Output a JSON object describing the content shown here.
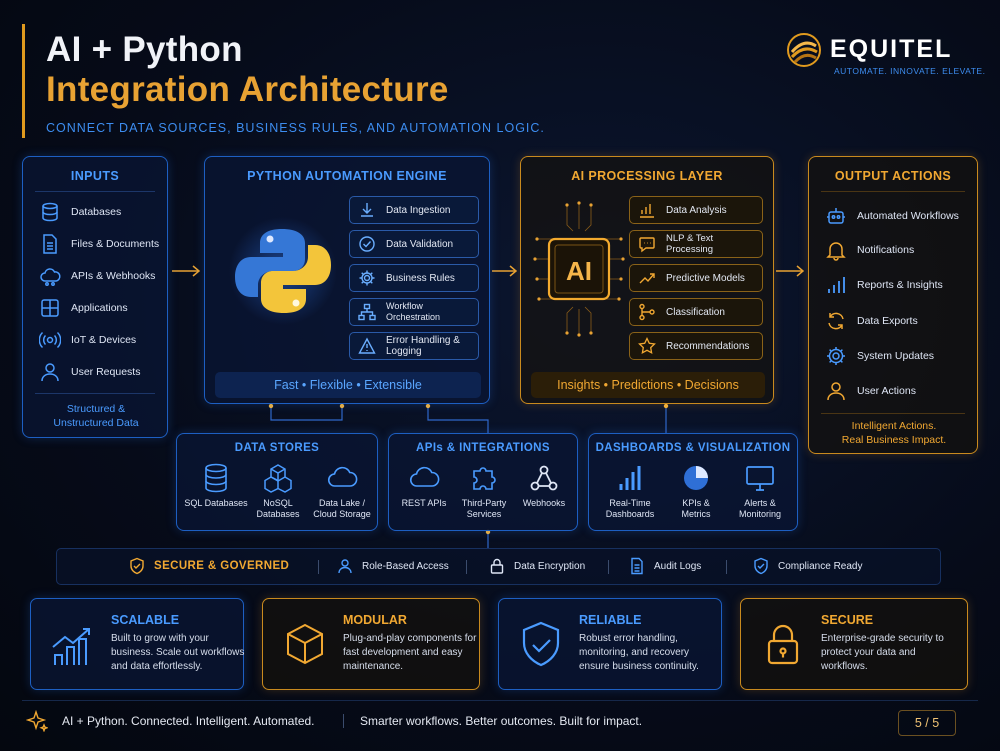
{
  "header": {
    "title_line1": "AI + Python",
    "title_line2": "Integration Architecture",
    "subtitle": "CONNECT DATA SOURCES, BUSINESS RULES, AND AUTOMATION LOGIC."
  },
  "brand": {
    "name": "EQUITEL",
    "tagline": "AUTOMATE. INNOVATE. ELEVATE."
  },
  "inputs": {
    "title": "INPUTS",
    "items": [
      "Databases",
      "Files & Documents",
      "APIs & Webhooks",
      "Applications",
      "IoT & Devices",
      "User Requests"
    ],
    "footer_line1": "Structured &",
    "footer_line2": "Unstructured Data"
  },
  "python_engine": {
    "title": "PYTHON AUTOMATION ENGINE",
    "steps": [
      "Data Ingestion",
      "Data Validation",
      "Business Rules",
      "Workflow Orchestration",
      "Error Handling &",
      "Logging"
    ],
    "footer": "Fast  •  Flexible  •  Extensible"
  },
  "ai_layer": {
    "title": "AI PROCESSING LAYER",
    "chip_label": "AI",
    "steps": [
      "Data Analysis",
      "NLP & Text Processing",
      "Predictive Models",
      "Classification",
      "Recommendations"
    ],
    "footer": "Insights  •  Predictions  •  Decisions"
  },
  "outputs": {
    "title": "OUTPUT ACTIONS",
    "items": [
      "Automated Workflows",
      "Notifications",
      "Reports & Insights",
      "Data Exports",
      "System Updates",
      "User Actions"
    ],
    "footer_line1": "Intelligent Actions.",
    "footer_line2": "Real Business Impact."
  },
  "data_stores": {
    "title": "DATA STORES",
    "items": [
      {
        "l1": "SQL Databases",
        "l2": ""
      },
      {
        "l1": "NoSQL",
        "l2": "Databases"
      },
      {
        "l1": "Data Lake /",
        "l2": "Cloud Storage"
      }
    ]
  },
  "apis": {
    "title": "APIs & INTEGRATIONS",
    "items": [
      {
        "l1": "REST APIs",
        "l2": ""
      },
      {
        "l1": "Third-Party",
        "l2": "Services"
      },
      {
        "l1": "Webhooks",
        "l2": ""
      }
    ]
  },
  "dashboards": {
    "title": "DASHBOARDS & VISUALIZATION",
    "items": [
      {
        "l1": "Real-Time",
        "l2": "Dashboards"
      },
      {
        "l1": "KPIs &",
        "l2": "Metrics"
      },
      {
        "l1": "Alerts &",
        "l2": "Monitoring"
      }
    ]
  },
  "governance": {
    "title": "SECURE & GOVERNED",
    "items": [
      "Role-Based Access",
      "Data Encryption",
      "Audit Logs",
      "Compliance Ready"
    ]
  },
  "cards": [
    {
      "title": "SCALABLE",
      "body": "Built to grow with your business. Scale out workflows and data effortlessly.",
      "accent": "blue"
    },
    {
      "title": "MODULAR",
      "body": "Plug-and-play components for fast development and easy maintenance.",
      "accent": "orange"
    },
    {
      "title": "RELIABLE",
      "body": "Robust error handling, monitoring, and recovery ensure business continuity.",
      "accent": "blue"
    },
    {
      "title": "SECURE",
      "body": "Enterprise-grade security to protect your data and workflows.",
      "accent": "orange"
    }
  ],
  "footer": {
    "left": "AI + Python. Connected. Intelligent. Automated.",
    "right": "Smarter workflows. Better outcomes. Built for impact.",
    "page": "5 / 5"
  },
  "colors": {
    "background": "#050a17",
    "blue_accent": "#3d8df0",
    "orange_accent": "#e8a233"
  }
}
